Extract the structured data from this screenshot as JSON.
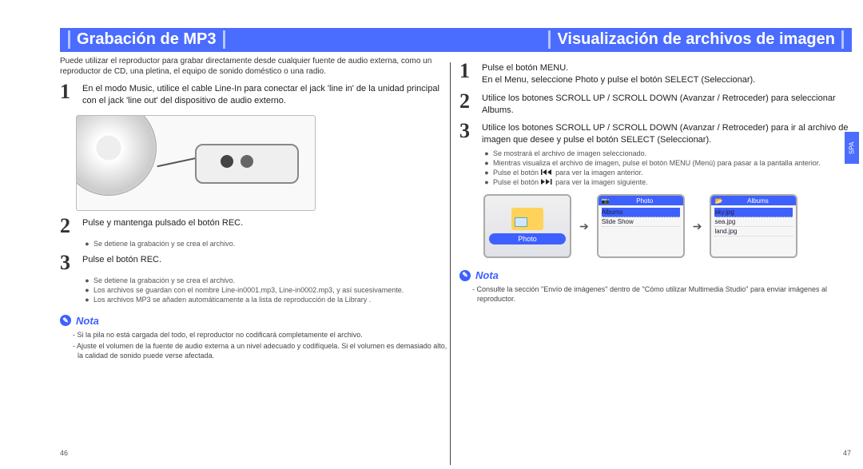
{
  "language_tab": "SPA",
  "headings": {
    "left": "Grabación de MP3",
    "right": "Visualización de archivos de imagen"
  },
  "left": {
    "intro": "Puede utilizar el reproductor para grabar directamente desde cualquier fuente de audio externa, como un reproductor de CD, una pletina, el equipo de sonido doméstico o una radio.",
    "steps": {
      "s1": "1",
      "t1": "En el modo Music, utilice el cable Line-In para conectar el jack 'line in' de la unidad principal con el jack 'line out' del dispositivo de audio externo.",
      "s2": "2",
      "t2": "Pulse y mantenga pulsado el botón REC.",
      "s3": "3",
      "t3": "Pulse el botón REC."
    },
    "bullets": {
      "b2a": "Se detiene la grabación y se crea el archivo.",
      "b3a": "Se detiene la grabación y se crea el archivo.",
      "b3b": "Los archivos se guardan con el nombre Line-in0001.mp3, Line-in0002.mp3, y así sucesivamente.",
      "b3c": "Los archivos MP3 se añaden automáticamente a la lista de reproducción de la Library ."
    },
    "note_label": "Nota",
    "notes": {
      "n1": "- Si la pila no está cargada del todo, el reproductor no codificará completamente el archivo.",
      "n2": "- Ajuste el volumen de la fuente de audio externa a un nivel adecuado y codifíquela. Si el volumen es demasiado alto, la calidad de sonido puede verse afectada."
    },
    "page_number": "46"
  },
  "right": {
    "steps": {
      "s1": "1",
      "t1a": "Pulse el botón MENU.",
      "t1b": "En el Menu, seleccione Photo y pulse el botón SELECT (Seleccionar).",
      "s2": "2",
      "t2": "Utilice los botones SCROLL UP / SCROLL DOWN (Avanzar / Retroceder) para seleccionar Albums.",
      "s3": "3",
      "t3": "Utilice los botones SCROLL UP / SCROLL DOWN (Avanzar / Retroceder) para ir al archivo de imagen que desee y pulse el botón SELECT (Seleccionar)."
    },
    "bullets": {
      "b1": "Se mostrará el archivo de imagen seleccionado.",
      "b2": "Mientras visualiza el archivo de imagen, pulse el botón MENU (Menú) para pasar a la pantalla anterior.",
      "b3_pre": "Pulse el botón",
      "b3_post": "para ver la imagen anterior.",
      "b4_pre": "Pulse el botón",
      "b4_post": "para ver la imagen siguiente."
    },
    "screens": {
      "photo_main_label": "Photo",
      "menu_header": "Photo",
      "menu_items": {
        "i1": "Albums",
        "i2": "Slide Show"
      },
      "albums_header": "Albums",
      "albums_items": {
        "a1": "sky.jpg",
        "a2": "sea.jpg",
        "a3": "land.jpg"
      },
      "arrow": "➔"
    },
    "note_label": "Nota",
    "notes": {
      "n1": "- Consulte la sección \"Envío de imágenes\" dentro de \"Cómo utilizar Multimedia Studio\" para enviar imágenes al reproductor."
    },
    "page_number": "47"
  }
}
